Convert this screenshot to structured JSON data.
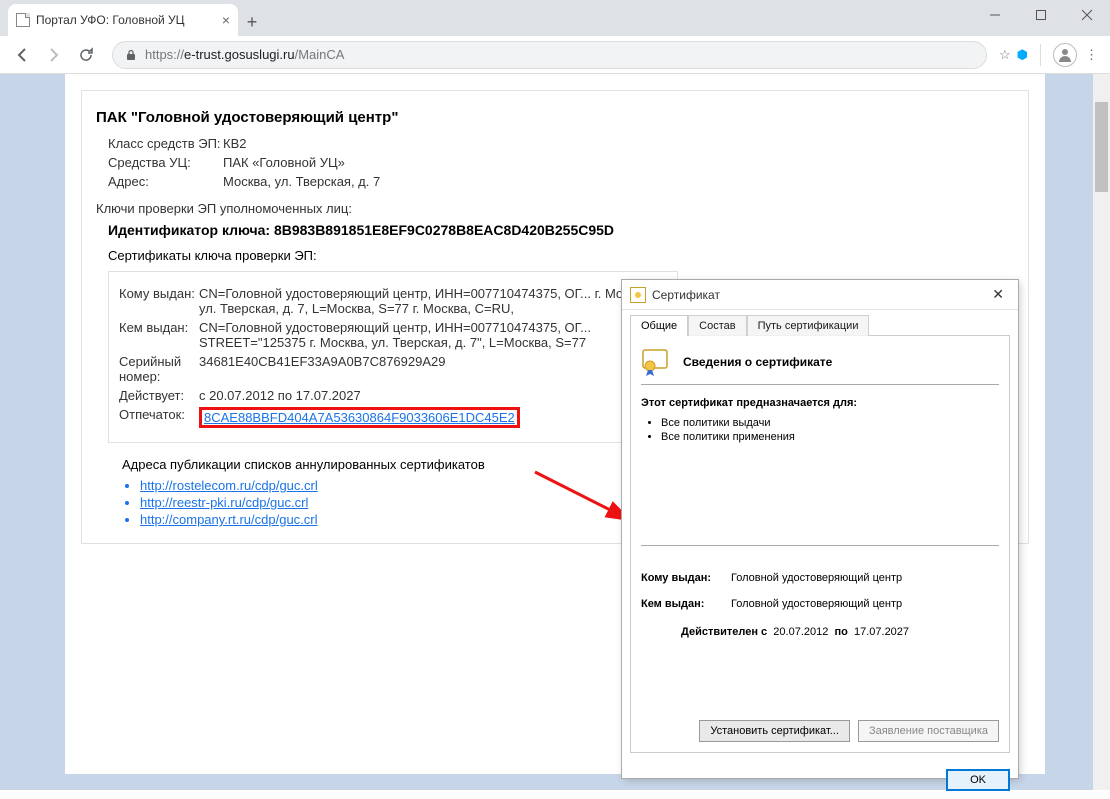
{
  "browser": {
    "tab_title": "Портал УФО: Головной УЦ",
    "url_scheme": "https://",
    "url_domain": "e-trust.gosuslugi.ru",
    "url_path": "/MainCA"
  },
  "page": {
    "heading": "ПАК \"Головной удостоверяющий центр\"",
    "class_label": "Класс средств ЭП:",
    "class_value": "КВ2",
    "tool_label": "Средства УЦ:",
    "tool_value": "ПАК «Головной УЦ»",
    "addr_label": "Адрес:",
    "addr_value": "Москва, ул. Тверская, д. 7",
    "keys_head": "Ключи проверки ЭП уполномоченных лиц:",
    "key_id_label": "Идентификатор ключа: ",
    "key_id_value": "8B983B891851E8EF9C0278B8EAC8D420B255C95D",
    "certs_head": "Сертификаты ключа проверки ЭП:",
    "cert": {
      "to_label": "Кому выдан:",
      "to_value": "CN=Головной удостоверяющий центр, ИНН=007710474375, ОГ...  г. Москва, ул. Тверская, д. 7, L=Москва, S=77 г. Москва, C=RU,",
      "by_label": "Кем выдан:",
      "by_value": "CN=Головной удостоверяющий центр, ИНН=007710474375, ОГ...  STREET=\"125375 г. Москва, ул. Тверская, д. 7\", L=Москва, S=77",
      "serial_label": "Серийный номер:",
      "serial_value": "34681E40CB41EF33A9A0B7C876929A29",
      "valid_label": "Действует:",
      "valid_value": "с 20.07.2012 по 17.07.2027",
      "thumb_label": "Отпечаток:",
      "thumb_value": "8CAE88BBFD404A7A53630864F9033606E1DC45E2"
    },
    "crl_head": "Адреса публикации списков аннулированных сертификатов",
    "crl_links": [
      "http://rostelecom.ru/cdp/guc.crl",
      "http://reestr-pki.ru/cdp/guc.crl",
      "http://company.rt.ru/cdp/guc.crl"
    ]
  },
  "dialog": {
    "title": "Сертификат",
    "tabs": [
      "Общие",
      "Состав",
      "Путь сертификации"
    ],
    "info_title": "Сведения о сертификате",
    "purpose_head": "Этот сертификат предназначается для:",
    "purposes": [
      "Все политики выдачи",
      "Все политики применения"
    ],
    "issued_to_label": "Кому выдан:",
    "issued_to_value": "Головной удостоверяющий центр",
    "issued_by_label": "Кем выдан:",
    "issued_by_value": "Головной удостоверяющий центр",
    "valid_prefix": "Действителен с",
    "valid_from": "20.07.2012",
    "valid_mid": "по",
    "valid_to": "17.07.2027",
    "install_btn": "Установить сертификат...",
    "issuer_btn": "Заявление поставщика",
    "ok_btn": "OK"
  }
}
